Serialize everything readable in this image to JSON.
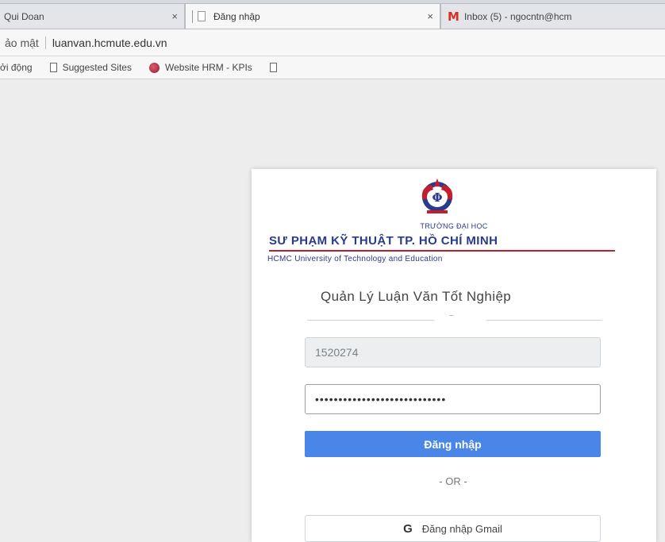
{
  "browser": {
    "tabs": [
      {
        "title": "Qui Doan",
        "active": false
      },
      {
        "title": "Đăng nhập",
        "active": true
      },
      {
        "title": "Inbox (5) - ngocntn@hcm",
        "active": false
      }
    ],
    "tab_close_glyph": "×",
    "address": {
      "security": "ảo mật",
      "url": "luanvan.hcmute.edu.vn"
    },
    "bookmarks": [
      {
        "label": "ởi động",
        "icon": "none"
      },
      {
        "label": "Suggested Sites",
        "icon": "page-icon"
      },
      {
        "label": "Website HRM - KPIs",
        "icon": "globe-icon"
      },
      {
        "label": "",
        "icon": "page-icon"
      }
    ]
  },
  "login": {
    "university": {
      "line1": "TRƯỜNG ĐẠI HỌC",
      "line2": "SƯ PHẠM KỸ THUẬT TP. HỒ CHÍ MINH",
      "line3": "HCMC University of Technology and Education"
    },
    "app_title": "Quản Lý Luận Văn Tốt Nghiệp",
    "divider_mark": "~",
    "username_value": "1520274",
    "password_value": "••••••••••••••••••••••••••••",
    "login_button": "Đăng nhập",
    "or_text": "- OR -",
    "gmail_button": "Đăng nhập Gmail",
    "gmail_icon_glyph": "G"
  },
  "colors": {
    "accent_blue": "#4a86e8",
    "brand_navy": "#2a3a8c",
    "brand_red": "#c0202e"
  }
}
